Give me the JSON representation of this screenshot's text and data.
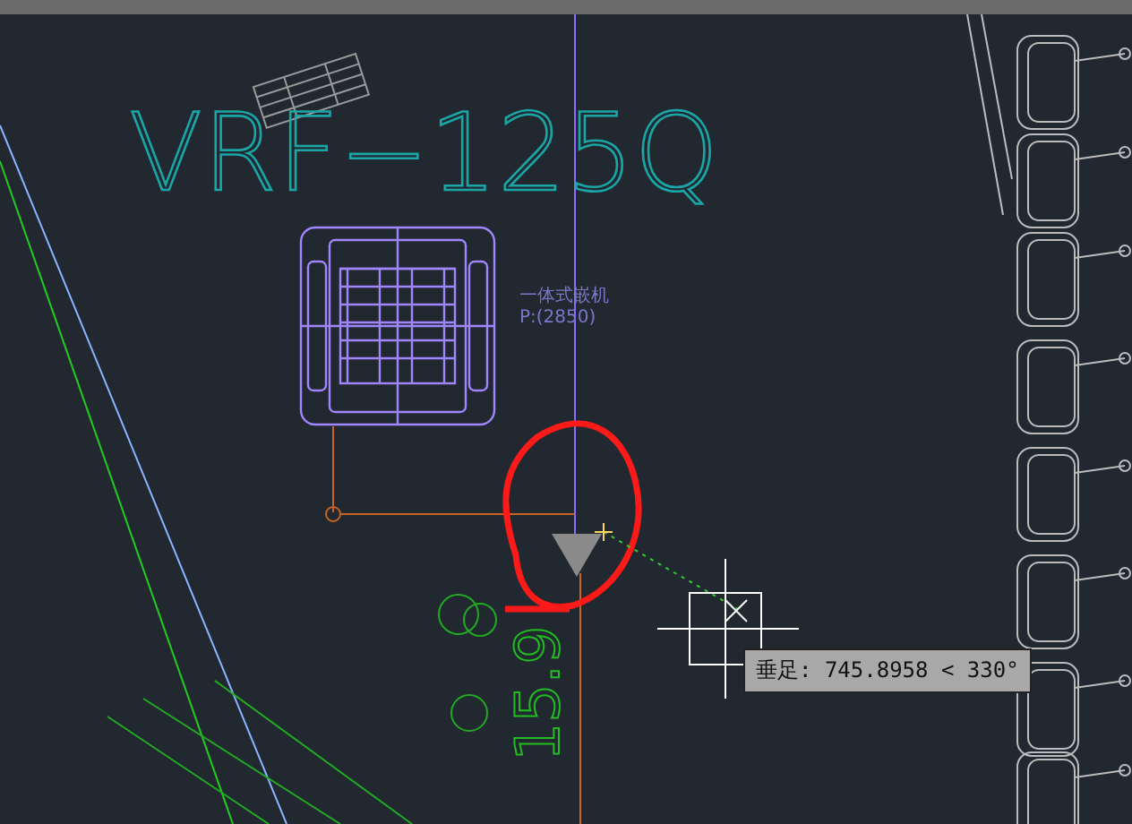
{
  "drawing": {
    "model_label": "VRF−125Q",
    "unit_note": [
      "一体式嵌机",
      "P:(2850)"
    ],
    "dimension_text": "15.9"
  },
  "osnap_tooltip": {
    "text": "垂足: 745.8958 < 330°"
  }
}
